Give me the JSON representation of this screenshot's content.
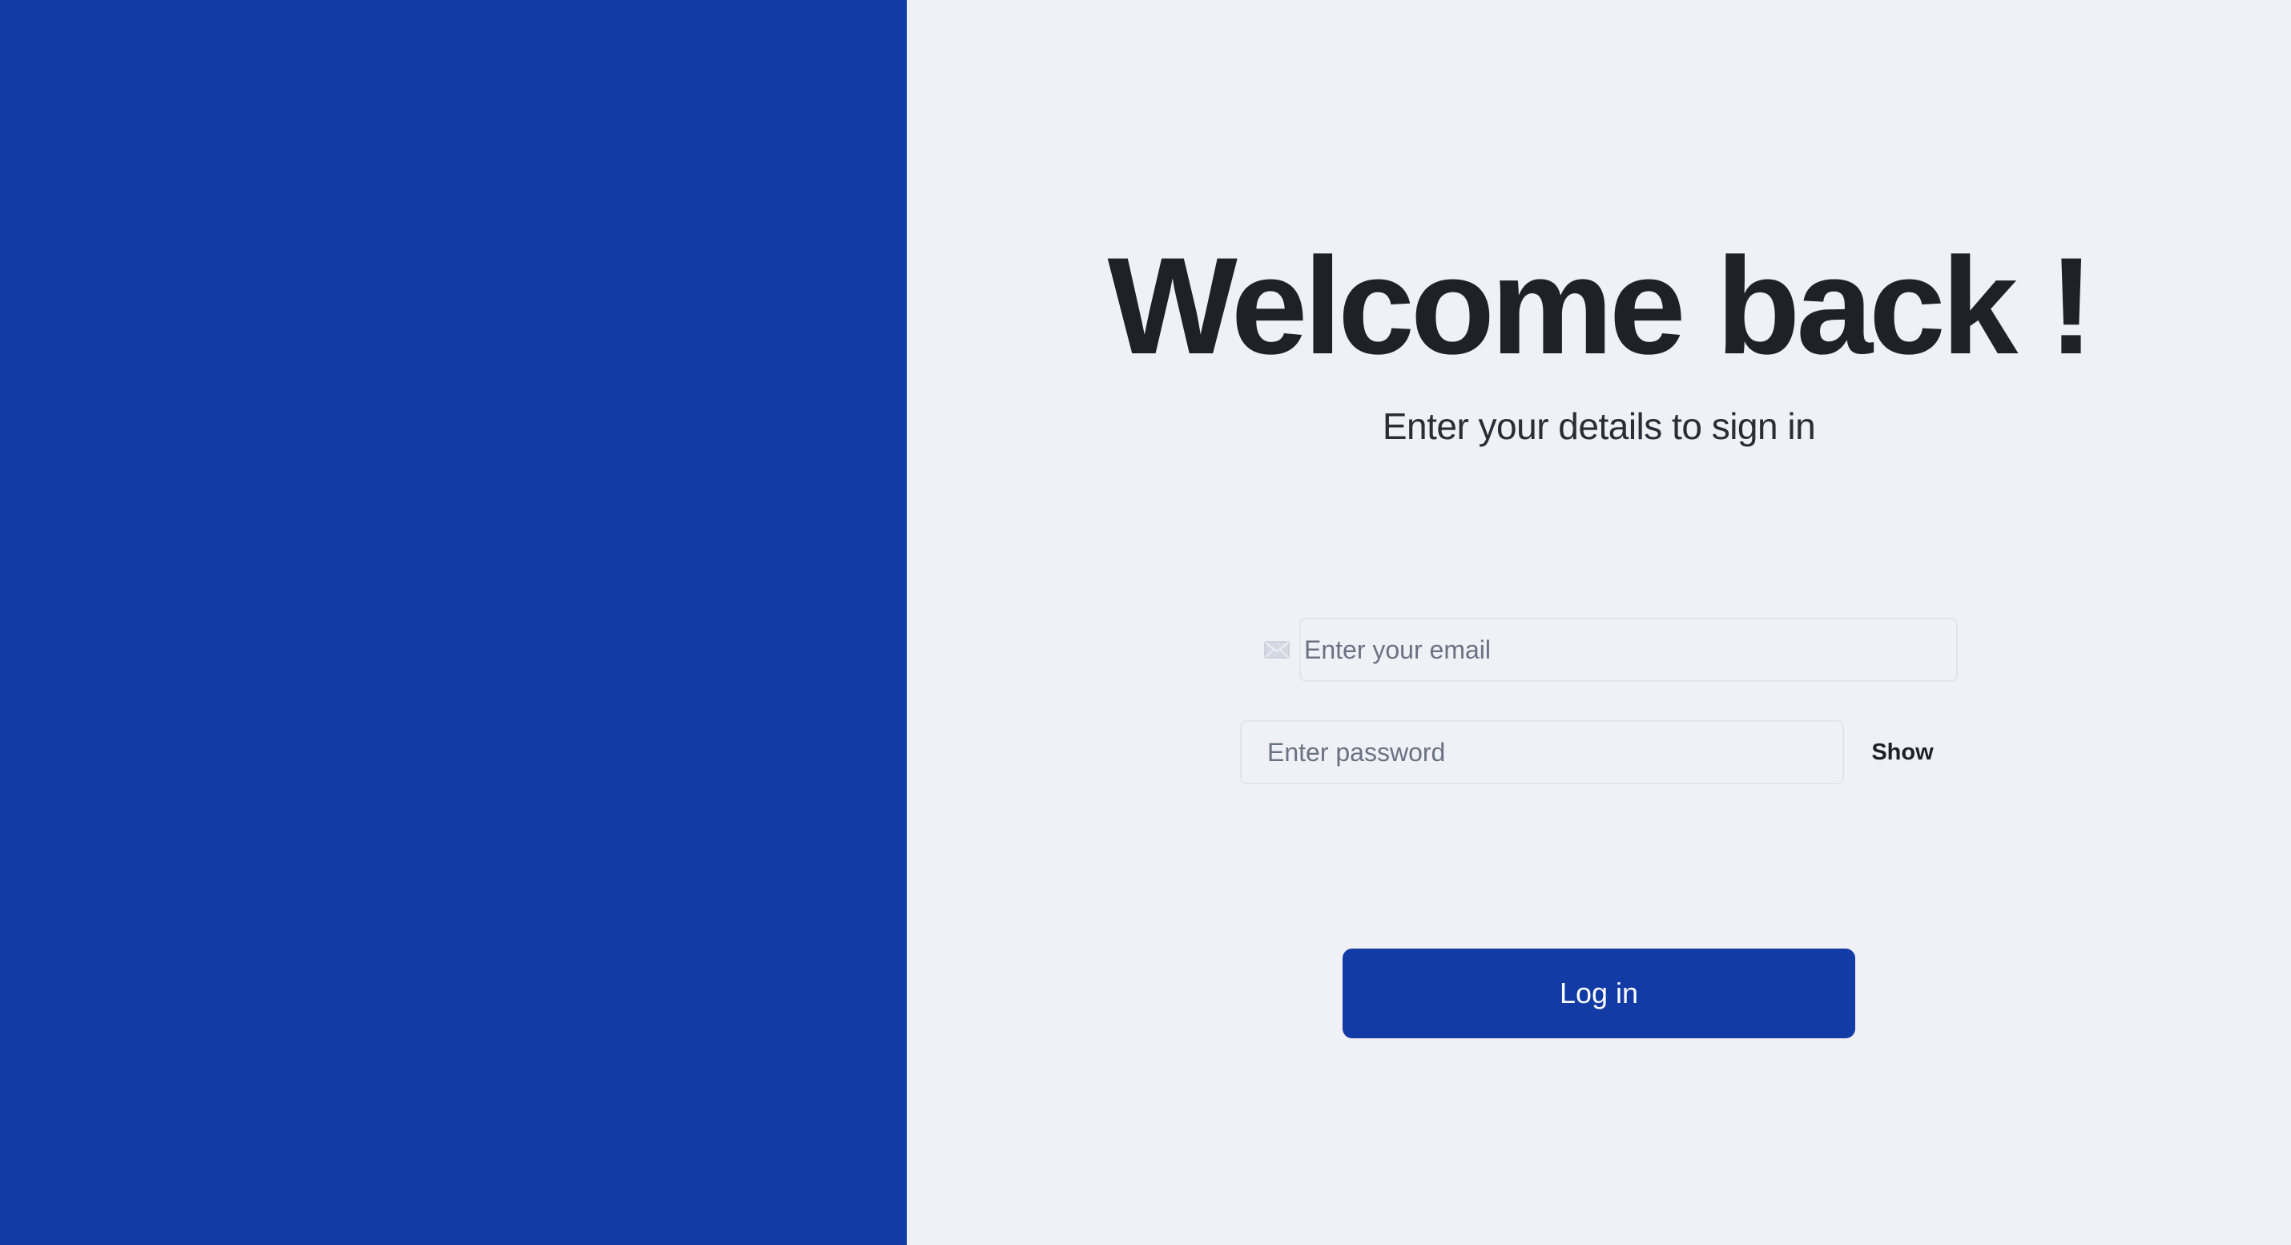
{
  "colors": {
    "brand": "#133ba6",
    "background": "#f0f1f6",
    "text": "#1e2128",
    "placeholder": "#6b7183"
  },
  "header": {
    "title": "Welcome back !",
    "subtitle": "Enter your details to sign in"
  },
  "form": {
    "email": {
      "icon": "mail-icon",
      "value": "",
      "placeholder": "Enter your email"
    },
    "password": {
      "value": "",
      "placeholder": "Enter password",
      "toggle_label": "Show"
    },
    "submit_label": "Log in"
  }
}
